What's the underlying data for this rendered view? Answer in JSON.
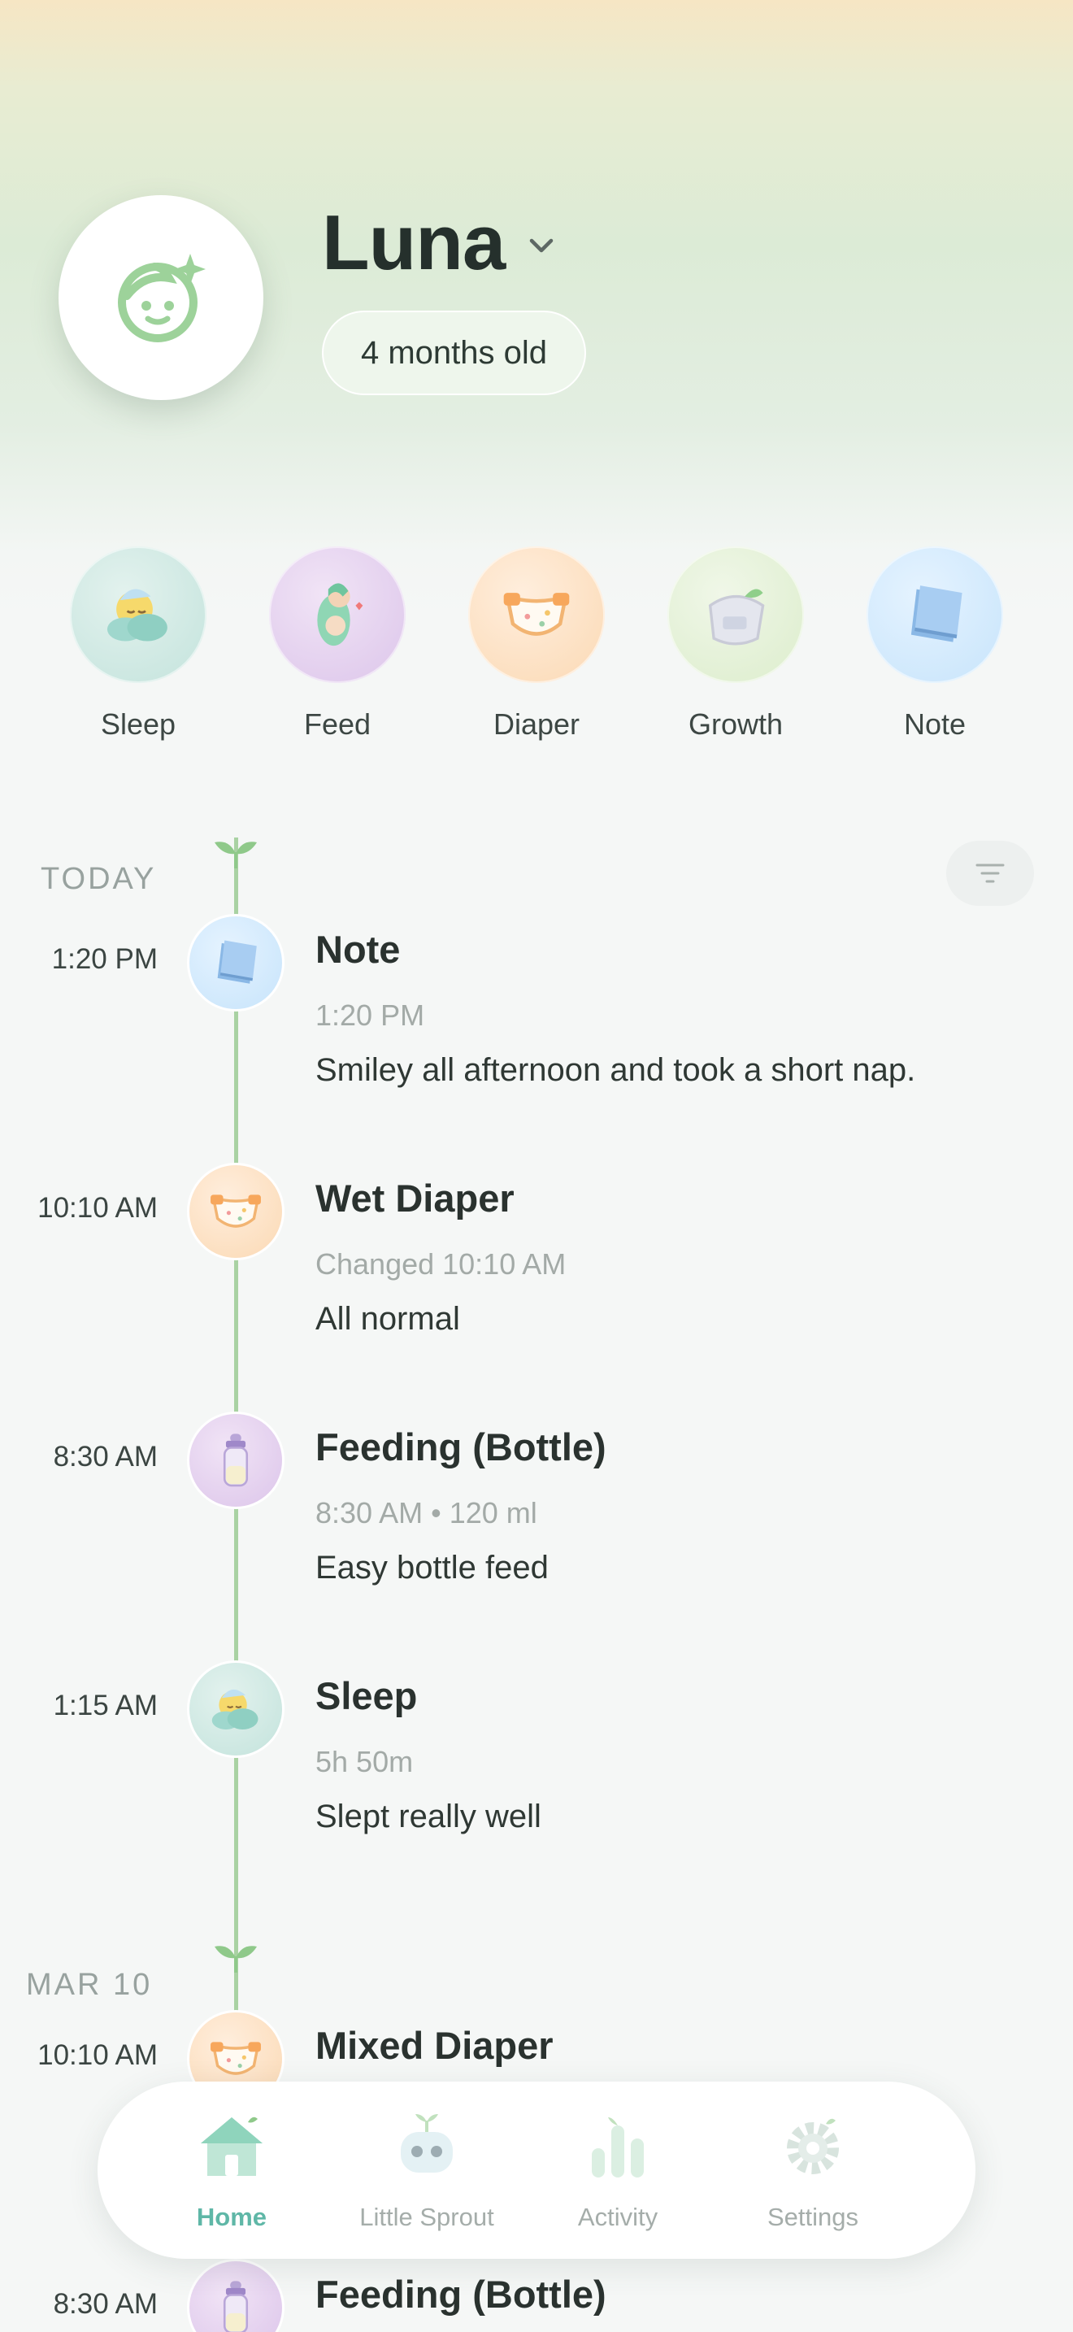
{
  "profile": {
    "name": "Luna",
    "age": "4 months old",
    "avatar_icon": "baby-face-sparkle-icon"
  },
  "quick_actions": [
    {
      "label": "Sleep",
      "icon": "sleep-cloud-icon",
      "color": "#c3e3dc"
    },
    {
      "label": "Feed",
      "icon": "feed-mother-icon",
      "color": "#dcc5ea"
    },
    {
      "label": "Diaper",
      "icon": "diaper-icon",
      "color": "#fbd9b4"
    },
    {
      "label": "Growth",
      "icon": "growth-scale-icon",
      "color": "#dcedcc"
    },
    {
      "label": "Note",
      "icon": "notebook-icon",
      "color": "#c7e4fb"
    }
  ],
  "timeline": {
    "today_label": "TODAY",
    "previous_label": "MAR 10",
    "entries": [
      {
        "time": "1:20 PM",
        "title": "Note",
        "sub": "1:20 PM",
        "note": "Smiley all afternoon and took a short nap.",
        "icon": "notebook-icon"
      },
      {
        "time": "10:10 AM",
        "title": "Wet Diaper",
        "sub": "Changed 10:10 AM",
        "note": "All normal",
        "icon": "diaper-icon"
      },
      {
        "time": "8:30 AM",
        "title": "Feeding (Bottle)",
        "sub": "8:30 AM • 120 ml",
        "note": "Easy bottle feed",
        "icon": "bottle-icon"
      },
      {
        "time": "1:15 AM",
        "title": "Sleep",
        "sub": "5h 50m",
        "note": "Slept really well",
        "icon": "sleep-cloud-icon"
      }
    ],
    "previous_entries": [
      {
        "time": "10:10 AM",
        "title": "Mixed Diaper",
        "icon": "diaper-icon"
      },
      {
        "time": "8:30 AM",
        "title": "Feeding (Bottle)",
        "icon": "bottle-icon"
      }
    ]
  },
  "nav": {
    "items": [
      {
        "label": "Home",
        "icon": "house-icon",
        "active": true
      },
      {
        "label": "Little Sprout",
        "icon": "robot-sprout-icon",
        "active": false
      },
      {
        "label": "Activity",
        "icon": "bar-chart-icon",
        "active": false
      },
      {
        "label": "Settings",
        "icon": "gear-icon",
        "active": false
      }
    ]
  },
  "colors": {
    "accent": "#5fb7a7",
    "rail": "#a9d2a3",
    "leaf": "#8fc98a"
  }
}
